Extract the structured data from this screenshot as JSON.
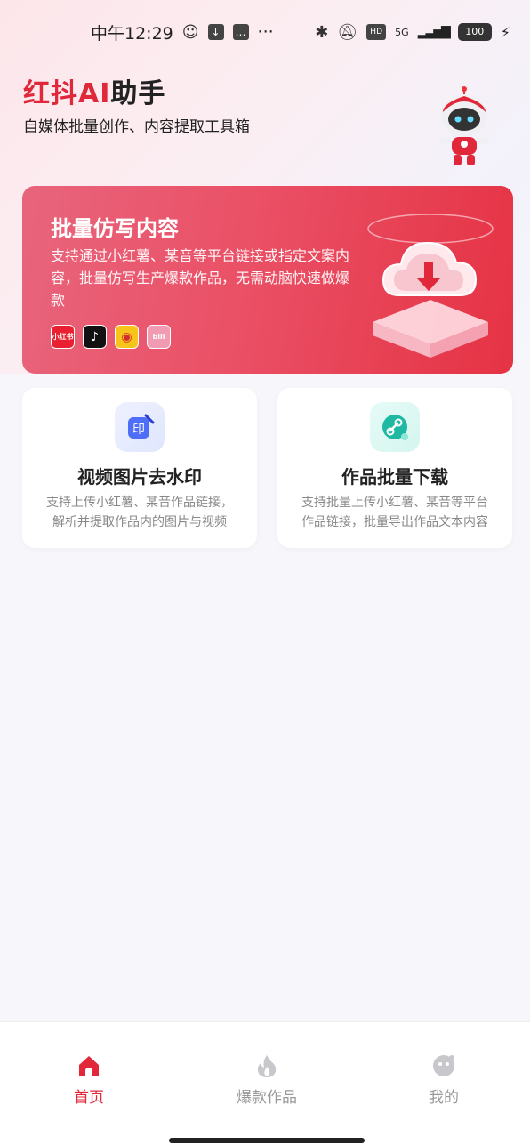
{
  "status_bar": {
    "time": "中午12:29",
    "more": "···",
    "network": "5G",
    "battery": "100"
  },
  "header": {
    "title_red": "红抖AI",
    "title_dark": "助手",
    "subtitle": "自媒体批量创作、内容提取工具箱"
  },
  "hero": {
    "title": "批量仿写内容",
    "description": "支持通过小红薯、某音等平台链接或指定文案内容，批量仿写生产爆款作品，无需动脑快速做爆款",
    "platforms": [
      {
        "name": "小红书",
        "icon": "xiaohongshu-icon"
      },
      {
        "name": "♪",
        "icon": "douyin-icon"
      },
      {
        "name": "◉",
        "icon": "weibo-icon"
      },
      {
        "name": "bili",
        "icon": "bilibili-icon"
      }
    ]
  },
  "cards": [
    {
      "title": "视频图片去水印",
      "desc_line1": "支持上传小红薯、某音作品链接，",
      "desc_line2": "解析并提取作品内的图片与视频",
      "icon": "watermark-stamp-icon",
      "icon_text": "印"
    },
    {
      "title": "作品批量下载",
      "desc_line1": "支持批量上传小红薯、某音等平台",
      "desc_line2": "作品链接，批量导出作品文本内容",
      "icon": "link-download-icon"
    }
  ],
  "bottom_nav": [
    {
      "label": "首页",
      "icon": "home-icon",
      "active": true
    },
    {
      "label": "爆款作品",
      "icon": "flame-icon",
      "active": false
    },
    {
      "label": "我的",
      "icon": "profile-face-icon",
      "active": false
    }
  ],
  "colors": {
    "brand_red": "#e0283a",
    "hero_gradient_start": "#e8657c",
    "hero_gradient_end": "#e53344",
    "inactive_gray": "#999999"
  }
}
